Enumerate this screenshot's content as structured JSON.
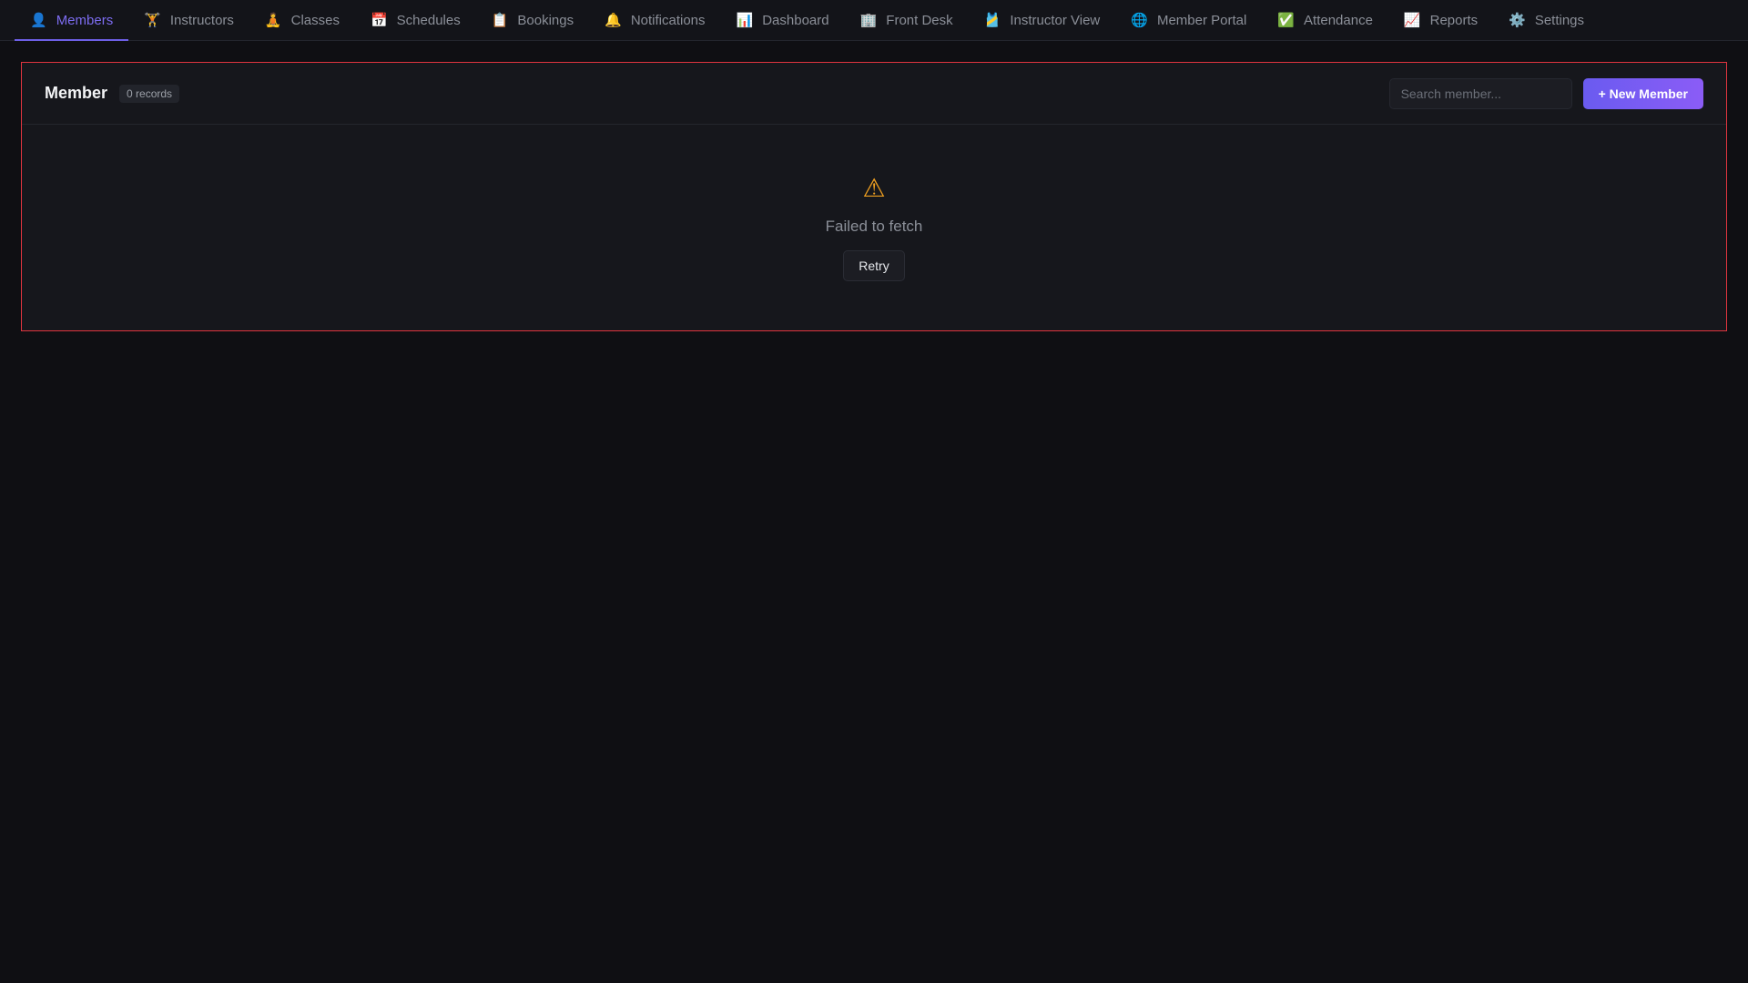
{
  "nav": {
    "tabs": [
      {
        "icon": "👤",
        "icon_name": "person-icon",
        "label": "Members",
        "active": true
      },
      {
        "icon": "🏋",
        "icon_name": "weightlifter-icon",
        "label": "Instructors"
      },
      {
        "icon": "🧘",
        "icon_name": "yoga-icon",
        "label": "Classes"
      },
      {
        "icon": "📅",
        "icon_name": "calendar-icon",
        "label": "Schedules"
      },
      {
        "icon": "📋",
        "icon_name": "clipboard-icon",
        "label": "Bookings"
      },
      {
        "icon": "🔔",
        "icon_name": "bell-icon",
        "label": "Notifications"
      },
      {
        "icon": "📊",
        "icon_name": "bar-chart-icon",
        "label": "Dashboard"
      },
      {
        "icon": "🏢",
        "icon_name": "office-building-icon",
        "label": "Front Desk"
      },
      {
        "icon": "🎽",
        "icon_name": "jersey-icon",
        "label": "Instructor View"
      },
      {
        "icon": "🌐",
        "icon_name": "globe-icon",
        "label": "Member Portal"
      },
      {
        "icon": "✅",
        "icon_name": "check-mark-icon",
        "label": "Attendance"
      },
      {
        "icon": "📈",
        "icon_name": "trend-chart-icon",
        "label": "Reports"
      },
      {
        "icon": "⚙️",
        "icon_name": "gear-icon",
        "label": "Settings"
      }
    ],
    "active_color": "#7c6cf0"
  },
  "panel": {
    "title": "Member",
    "count_badge": "0 records",
    "search_placeholder": "Search member...",
    "search_value": "",
    "new_button_label": "+ New Member",
    "border_color": "#e0343f",
    "accent_color": "#6a5bf0"
  },
  "error": {
    "icon": "⚠",
    "icon_name": "warning-icon",
    "icon_color": "#f0a020",
    "message": "Failed to fetch",
    "retry_label": "Retry"
  }
}
